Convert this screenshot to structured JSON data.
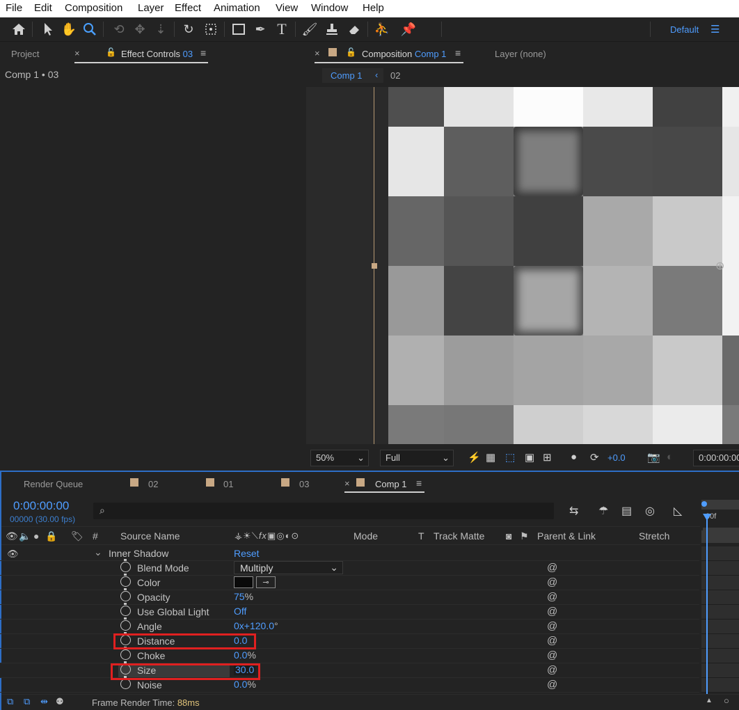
{
  "menu": [
    "File",
    "Edit",
    "Composition",
    "Layer",
    "Effect",
    "Animation",
    "View",
    "Window",
    "Help"
  ],
  "workspace": {
    "label": "Default"
  },
  "left_panel": {
    "tab_project": "Project",
    "tab_effect_controls": "Effect Controls",
    "tab_effect_controls_layer": "03",
    "breadcrumb": "Comp 1 • 03"
  },
  "comp_panel": {
    "tab_label": "Composition",
    "tab_comp": "Comp 1",
    "layer_tab": "Layer (none)",
    "crumb_comp": "Comp 1",
    "crumb_layer": "02",
    "zoom": "50%",
    "resolution": "Full",
    "exposure": "+0.0",
    "timecode": "0:00:00:00"
  },
  "timeline": {
    "tabs": [
      "Render Queue",
      "02",
      "01",
      "03",
      "Comp 1"
    ],
    "current_time": "0:00:00:00",
    "frame_info": "00000 (30.00 fps)",
    "search_placeholder": "",
    "ruler_label": "00f",
    "headers": {
      "hash": "#",
      "source_name": "Source Name",
      "mode": "Mode",
      "t": "T",
      "track_matte": "Track Matte",
      "parent_link": "Parent & Link",
      "stretch": "Stretch"
    },
    "effect_group": {
      "name": "Inner Shadow",
      "reset": "Reset"
    },
    "properties": [
      {
        "name": "Blend Mode",
        "value": "Multiply"
      },
      {
        "name": "Color",
        "value": ""
      },
      {
        "name": "Opacity",
        "value": "75",
        "unit": "%"
      },
      {
        "name": "Use Global Light",
        "value": "Off"
      },
      {
        "name": "Angle",
        "value": "0",
        "value2": "x+120.0",
        "unit": "°"
      },
      {
        "name": "Distance",
        "value": "0.0"
      },
      {
        "name": "Choke",
        "value": "0.0",
        "unit": "%"
      },
      {
        "name": "Size",
        "value": "30.0"
      },
      {
        "name": "Noise",
        "value": "0.0",
        "unit": "%"
      }
    ],
    "footer": {
      "label": "Frame Render Time:",
      "value": "88ms"
    }
  },
  "colors": {
    "accent": "#4f9dff",
    "highlight": "#e02020",
    "panel_border": "#2d6ec7"
  }
}
